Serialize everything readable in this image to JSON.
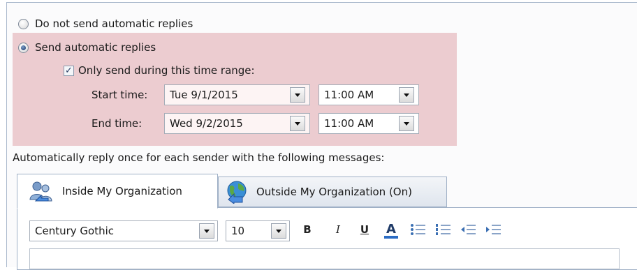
{
  "options": {
    "do_not_send": "Do not send automatic replies",
    "send": "Send automatic replies",
    "send_selected": true,
    "time_range": "Only send during this time range:",
    "time_range_checked": true
  },
  "start": {
    "label": "Start time:",
    "date": "Tue 9/1/2015",
    "time": "11:00 AM"
  },
  "end": {
    "label": "End time:",
    "date": "Wed 9/2/2015",
    "time": "11:00 AM"
  },
  "instructions": "Automatically reply once for each sender with the following messages:",
  "tabs": [
    {
      "label": "Inside My Organization",
      "icon": "people-icon",
      "active": true
    },
    {
      "label": "Outside My Organization (On)",
      "icon": "globe-icon",
      "active": false
    }
  ],
  "toolbar": {
    "font": "Century Gothic",
    "size": "10",
    "bold": "B",
    "italic": "I",
    "underline": "U",
    "font_color": "A"
  },
  "colors": {
    "highlight": "#ecccd0",
    "accent": "#2b6cc4"
  }
}
